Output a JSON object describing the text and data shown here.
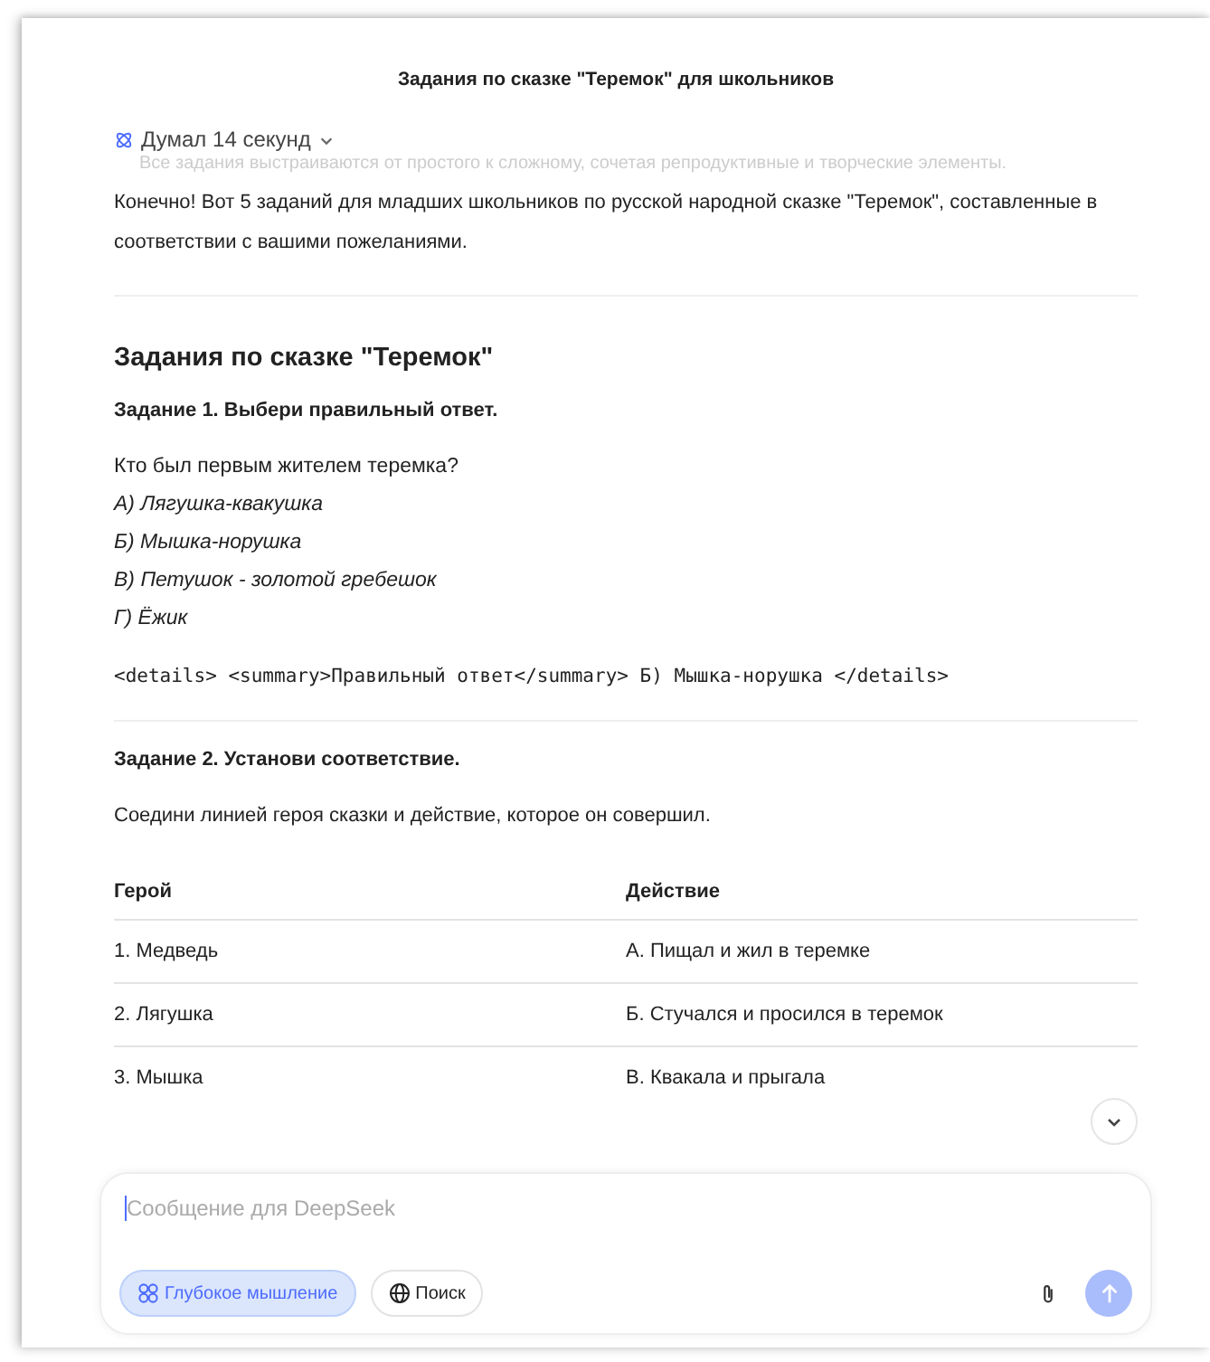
{
  "window": {
    "title": "Задания по сказке \"Теремок\" для школьников"
  },
  "thinking": {
    "label": "Думал 14 секунд",
    "expanded": false,
    "faded_text": "Все задания выстраиваются от простого к сложному, сочетая репродуктивные и творческие элементы."
  },
  "intro": "Конечно! Вот 5 заданий для младших школьников по русской народной сказке \"Теремок\", составленные в соответствии с вашими пожеланиями.",
  "heading": "Задания по сказке \"Теремок\"",
  "task1": {
    "title": "Задание 1. Выбери правильный ответ.",
    "question": "Кто был первым жителем теремка?",
    "options": [
      "А) Лягушка-квакушка",
      "Б) Мышка-норушка",
      "В) Петушок - золотой гребешок",
      "Г) Ёжик"
    ],
    "code": "<details> <summary>Правильный ответ</summary> Б) Мышка-норушка </details>"
  },
  "task2": {
    "title": "Задание 2. Установи соответствие.",
    "instruction": "Соедини линией героя сказки и действие, которое он совершил.",
    "table": {
      "columns": [
        "Герой",
        "Действие"
      ],
      "rows": [
        [
          "1. Медведь",
          "А. Пищал и жил в теремке"
        ],
        [
          "2. Лягушка",
          "Б. Стучался и просился в теремок"
        ],
        [
          "3. Мышка",
          "В. Квакала и прыгала"
        ]
      ]
    }
  },
  "composer": {
    "placeholder": "Сообщение для DeepSeek",
    "toggles": [
      {
        "label": "Глубокое мышление",
        "kind": "think",
        "selected": true
      },
      {
        "label": "Поиск",
        "kind": "search",
        "selected": false
      }
    ],
    "send_disabled": true
  }
}
